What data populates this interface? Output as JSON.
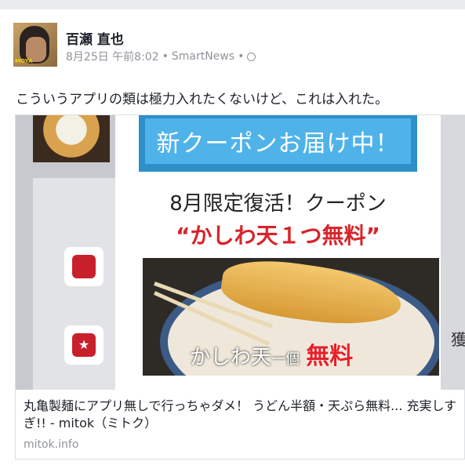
{
  "post": {
    "author": "百瀬 直也",
    "avatar_tag": "MOYA",
    "date": "8月25日 午前8:02",
    "sep1": "•",
    "source": "SmartNews",
    "sep2": "•",
    "text": "こういうアプリの類は極力入れたくないけど、これは入れた。"
  },
  "link": {
    "banner": "新クーポンお届け中！",
    "headline": "8月限定復活！クーポン",
    "offer": "“かしわ天１つ無料”",
    "photo_caption": "かしわ天",
    "photo_caption_small": "一個",
    "photo_caption_free": "無料",
    "bg_partial_char": "獲",
    "title": "丸亀製麺にアプリ無しで行っちゃダメ！ うどん半額・天ぷら無料... 充実しすぎ!! - mitok（ミトク）",
    "domain": "mitok.info"
  }
}
